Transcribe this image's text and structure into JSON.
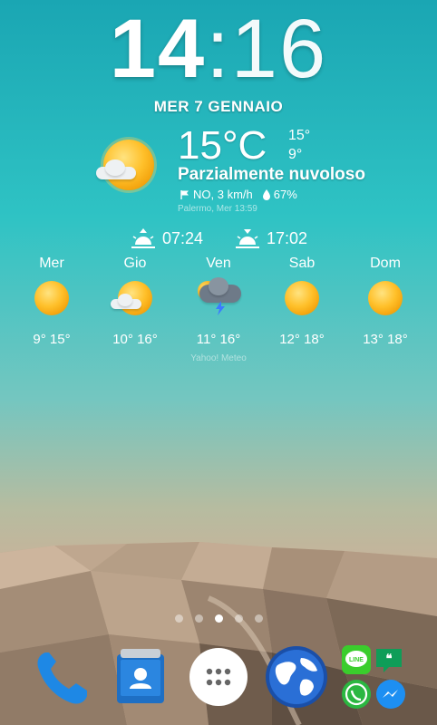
{
  "clock": {
    "hours": "14",
    "separator": ":",
    "minutes": "16"
  },
  "date": "MER 7 GENNAIO",
  "weather": {
    "temperature": "15°C",
    "high": "15°",
    "low": "9°",
    "condition": "Parzialmente nuvoloso",
    "wind": "NO, 3 km/h",
    "humidity": "67%",
    "location_time": "Palermo, Mer 13:59",
    "sunrise": "07:24",
    "sunset": "17:02"
  },
  "forecast": [
    {
      "day": "Mer",
      "range": "9° 15°",
      "icon": "sunny-icon"
    },
    {
      "day": "Gio",
      "range": "10° 16°",
      "icon": "partly-cloudy-icon"
    },
    {
      "day": "Ven",
      "range": "11° 16°",
      "icon": "thunderstorm-icon"
    },
    {
      "day": "Sab",
      "range": "12° 18°",
      "icon": "sunny-icon"
    },
    {
      "day": "Dom",
      "range": "13° 18°",
      "icon": "sunny-icon"
    }
  ],
  "provider": "Yahoo! Meteo",
  "pages": {
    "count": 5,
    "active_index": 2
  },
  "dock": {
    "apps": [
      "phone-icon",
      "contacts-icon",
      "app-drawer-icon",
      "browser-icon",
      "messaging-folder-icon"
    ],
    "folder_labels": {
      "line": "LINE"
    }
  },
  "colors": {
    "sky_top": "#1aa6b3",
    "sun": "#ffc02a",
    "accent_blue": "#1e88e5"
  }
}
